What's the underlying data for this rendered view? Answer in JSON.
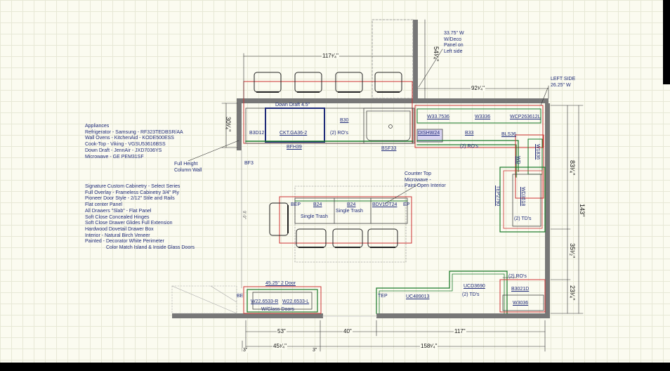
{
  "appliances_notes": {
    "heading": "Appliances",
    "lines": [
      "Refrigerator - Samsung - RF323TEDBSR/AA",
      "Wall Ovens - KitchenAid - KODE500ESS",
      "Cook-Top - Viking - VGSU53616BSS",
      "Down Draft - JennAir - JXD7036YS",
      "Microwave - GE PEM31SF"
    ]
  },
  "spec_notes": {
    "lines": [
      "Signature Custom Cabinetry - Select Series",
      "Full Overlay - Frameless Cabinetry 3/4\" Ply",
      "Pioneer Door Style - 2/12\" Stile and Rails",
      "Flat center Panel",
      "All Drawers \"Slab\" - Flat Panel",
      "Soft Close Concealed Hinges",
      "Soft Close Drawer Glides Full Extension",
      "Hardwood Dovetail Drawer Box",
      "Interior - Natural Birch Veneer",
      "Painted - Decorator White Perimeter",
      "Color Match Island & Inside Glass Doors"
    ]
  },
  "callouts": {
    "full_height_wall_1": "Full Height",
    "full_height_wall_2": "Column Wall",
    "bf3": "BF3",
    "fridge_note_1": "33.75\" W",
    "fridge_note_2": "W/Deco",
    "fridge_note_3": "Panel on",
    "fridge_note_4": "Left side",
    "left_side_1": "LEFT SIDE",
    "left_side_2": "26.25\" W",
    "microwave_1": "Counter Top",
    "microwave_2": "Microwave -",
    "microwave_3": "Paint Open Interior",
    "glass_door_top": "45.25\" 2 Door",
    "glass_doors": "W/Glass Doors"
  },
  "cabinets": {
    "down_draft": "Down Draft 4.5\"",
    "b3d12": "B3D12",
    "cooktop": "CKT.GA36-2",
    "b30": "B30",
    "ros_1": "(2) RO's",
    "bfh39": "BFH39",
    "bsf33": "BSF33",
    "w337536": "W33.7536",
    "w3336_top": "W3336",
    "wcp": "WCP263612L",
    "dishw": "DISHW24",
    "b33": "B33",
    "bls36": "BLS36",
    "ros_2": "(2) RO's",
    "w1836": "W1836",
    "wd": "WD",
    "tep": "TEP2790",
    "wd3618": "WD3618",
    "tds_1": "(2) TD's",
    "isl_b24a": "B24",
    "isl_b24b": "B24",
    "single_trash_1": "Single Trash",
    "single_trash_2": "Single Trash",
    "bdv": "BDV1DT24",
    "ep": "EP",
    "bep": "BEP",
    "ros_3": "(2) RO's",
    "ucd3690": "UCD3690",
    "tds_2": "(2) TD's",
    "b3021d": "B3021D",
    "w3036": "W3036",
    "tep_bottom": "TEP",
    "uc": "UC489013",
    "w22_r": "W22.6533-R",
    "w22_l": "W22.6533-L",
    "be": "BE"
  },
  "dimensions": {
    "top_117": "117¹⁄₄\"",
    "top_92": "92¹⁄₄\"",
    "v_54": "54¹⁄₄\"",
    "v_30": "30¹⁄₄\"",
    "v_83": "83¹⁄₄\"",
    "v_143": "143\"",
    "v_35": "35¹⁄₂\"",
    "v_23": "23¹⁄₄\"",
    "v_left": "9'-9\"",
    "b_53": "53\"",
    "b_40": "40\"",
    "b_117": "117\"",
    "b_45": "45¹⁄₄\"",
    "b_158": "158¹⁄₄\"",
    "b_3a": "3\"",
    "b_3b": "3\""
  }
}
